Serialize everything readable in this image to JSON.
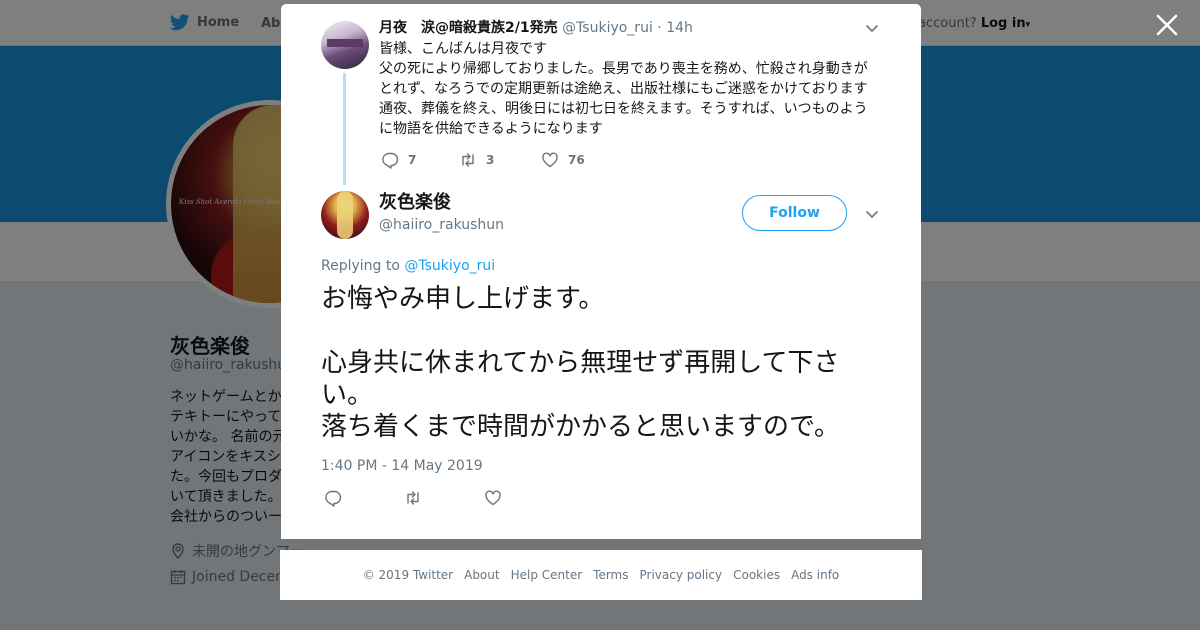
{
  "nav": {
    "home": "Home",
    "about": "Abo",
    "account_prompt": "account?",
    "login": "Log in"
  },
  "profile": {
    "name": "灰色楽俊",
    "handle": "@haiiro_rakushun",
    "bio_lines": [
      "ネットゲームとか",
      "テキトーにやって",
      "いかな。 名前の元",
      "アイコンをキスシ",
      "た。今回もプロダ",
      "いて頂きました。",
      "会社からのついー"
    ],
    "location": "未開の地グンマー",
    "joined": "Joined Decem",
    "avatar_caption": "Kiss Shot Acerola Orion Heart Under Blade"
  },
  "parent_tweet": {
    "name": "月夜　涙@暗殺貴族2/1発売",
    "handle": "@Tsukiyo_rui",
    "time": "· 14h",
    "lines": [
      "皆様、こんばんは月夜です",
      "父の死により帰郷しておりました。長男であり喪主を務め、忙殺され身動きが",
      "とれず、なろうでの定期更新は途絶え、出版社様にもご迷惑をかけております",
      "通夜、葬儀を終え、明後日には初七日を終えます。そうすれば、いつものよう",
      "に物語を供給できるようになります"
    ],
    "replies": "7",
    "retweets": "3",
    "likes": "76"
  },
  "main_tweet": {
    "name": "灰色楽俊",
    "handle": "@haiiro_rakushun",
    "follow_label": "Follow",
    "replying_prefix": "Replying to",
    "replying_to": "@Tsukiyo_rui",
    "text_lines": [
      "お悔やみ申し上げます。",
      "",
      "心身共に休まれてから無理せず再開して下さい。",
      "落ち着くまで時間がかかると思いますので。"
    ],
    "date": "1:40 PM - 14 May 2019"
  },
  "footer": {
    "copyright": "© 2019 Twitter",
    "links": [
      "About",
      "Help Center",
      "Terms",
      "Privacy policy",
      "Cookies",
      "Ads info"
    ]
  },
  "colors": {
    "twitter_blue": "#1da1f2",
    "banner": "#1b95e0",
    "thread_line": "#b3dff5",
    "secondary_text": "#657786"
  }
}
